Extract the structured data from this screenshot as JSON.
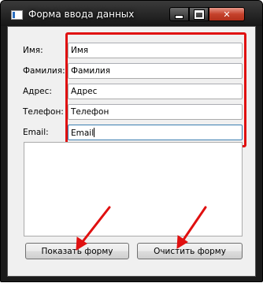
{
  "window": {
    "title": "Форма ввода данных",
    "controls": {
      "minimize": "minimize",
      "maximize": "maximize",
      "close": "✕"
    }
  },
  "form": {
    "fields": [
      {
        "label": "Имя:",
        "value": "Имя"
      },
      {
        "label": "Фамилия:",
        "value": "Фамилия"
      },
      {
        "label": "Адрес:",
        "value": "Адрес"
      },
      {
        "label": "Телефон:",
        "value": "Телефон"
      },
      {
        "label": "Email:",
        "value": "Email"
      }
    ],
    "output_text": ""
  },
  "buttons": {
    "show_form": "Показать форму",
    "clear_form": "Очистить форму"
  },
  "annotations": {
    "highlight_color": "#e01010",
    "arrow_color": "#e01010"
  },
  "icons": {
    "app": "window-app-icon",
    "minimize": "minimize-icon",
    "maximize": "maximize-icon",
    "close": "close-icon"
  }
}
